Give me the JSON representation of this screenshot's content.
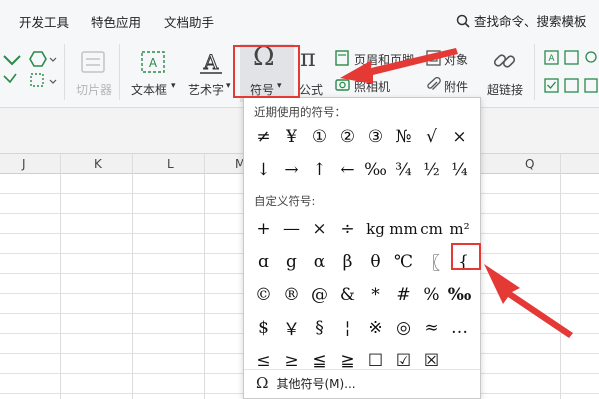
{
  "menubar": {
    "items": [
      "开发工具",
      "特色应用",
      "文档助手"
    ],
    "search_label": "查找命令、搜索模板"
  },
  "ribbon": {
    "screenshot_label": "切片器",
    "textbox_label": "文本框",
    "wordart_label": "艺术字",
    "symbol_label": "符号",
    "formula_label": "公式",
    "header_footer_label": "页眉和页脚",
    "camera_label": "照相机",
    "object_label": "对象",
    "attachment_label": "附件",
    "hyperlink_label": "超链接"
  },
  "grid": {
    "columns": [
      "J",
      "K",
      "L",
      "M",
      "Q"
    ]
  },
  "symbol_popup": {
    "recent_title": "近期使用的符号：",
    "recent_row1": [
      "≠",
      "¥",
      "①",
      "②",
      "③",
      "№",
      "√",
      "×"
    ],
    "recent_row2": [
      "↓",
      "→",
      "↑",
      "←",
      "‰",
      "¾",
      "½",
      "¼"
    ],
    "custom_title": "自定义符号:",
    "custom_row1": [
      "+",
      "—",
      "×",
      "÷",
      "kg",
      "mm",
      "cm",
      "m²"
    ],
    "custom_row2": [
      "ɑ",
      "g",
      "α",
      "β",
      "θ",
      "℃",
      "〖",
      "{"
    ],
    "custom_row3": [
      "©",
      "®",
      "@",
      "&",
      "*",
      "#",
      "%",
      "‰"
    ],
    "custom_row4": [
      "$",
      "￥",
      "§",
      "¦",
      "※",
      "◎",
      "≈",
      "…"
    ],
    "custom_row5": [
      "≤",
      "≥",
      "≦",
      "≧",
      "☐",
      "☑",
      "☒"
    ],
    "more_label": "其他符号(M)...",
    "more_icon": "Ω"
  },
  "colors": {
    "annotation_red": "#e53935",
    "ribbon_bg": "#f6f7f9",
    "icon_green": "#2a8a4a"
  }
}
